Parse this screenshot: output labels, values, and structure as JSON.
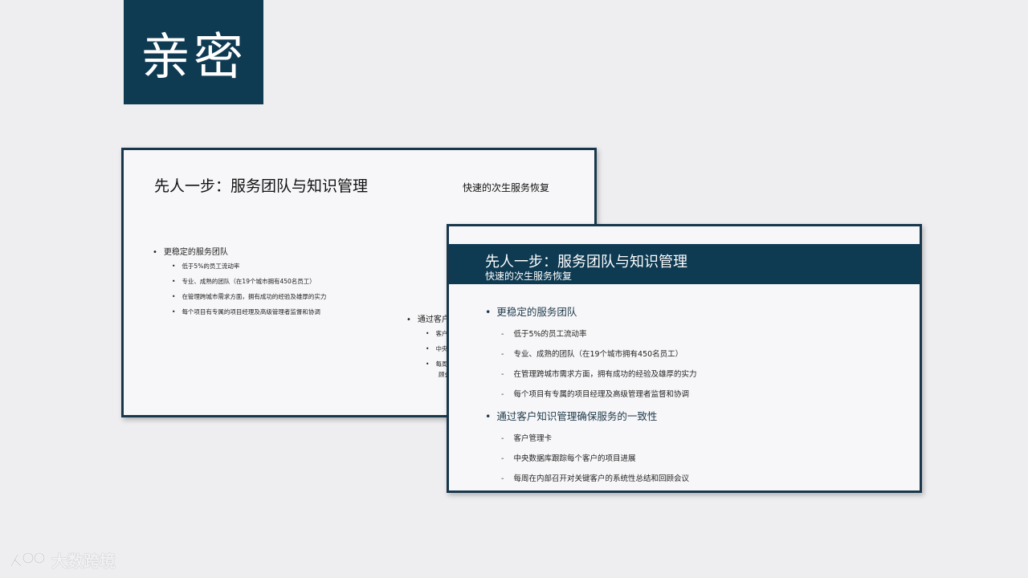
{
  "title": "亲密",
  "slide_back": {
    "title": "先人一步：服务团队与知识管理",
    "subtitle": "快速的次生服务恢复",
    "group1": {
      "heading": "更稳定的服务团队",
      "items": [
        "低于5%的员工流动率",
        "专业、成熟的团队（在19个城市拥有450名员工）",
        "在管理跨城市需求方面，拥有成功的经验及雄厚的实力",
        "每个项目有专属的项目经理及高级管理者监督和协调"
      ]
    },
    "group2": {
      "heading": "通过客户",
      "items": [
        "客户",
        "中央",
        "每周",
        "顾会"
      ]
    }
  },
  "slide_front": {
    "title": "先人一步：服务团队与知识管理",
    "subtitle": "快速的次生服务恢复",
    "groups": [
      {
        "heading": "更稳定的服务团队",
        "items": [
          "低于5%的员工流动率",
          "专业、成熟的团队（在19个城市拥有450名员工）",
          "在管理跨城市需求方面，拥有成功的经验及雄厚的实力",
          "每个项目有专属的项目经理及高级管理者监督和协调"
        ]
      },
      {
        "heading": "通过客户知识管理确保服务的一致性",
        "items": [
          "客户管理卡",
          "中央数据库跟踪每个客户的项目进展",
          "每周在内部召开对关键客户的系统性总结和回顾会议"
        ]
      }
    ]
  },
  "watermark": {
    "text": "大数跨境",
    "icon": "logo-mark-icon"
  },
  "colors": {
    "accent": "#0e3a52",
    "border": "#17374b",
    "background": "#eeeef1"
  }
}
